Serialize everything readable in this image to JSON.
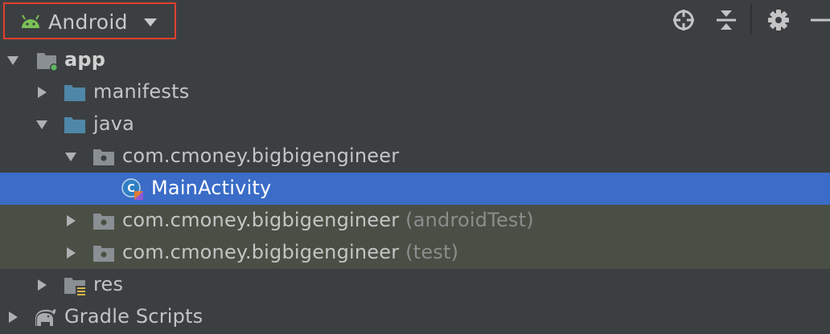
{
  "toolbar": {
    "view_label": "Android",
    "icons": [
      "android-icon",
      "dropdown-arrow-icon",
      "locate-icon",
      "collapse-all-icon",
      "gear-icon",
      "minimize-icon"
    ]
  },
  "tree": {
    "app": "app",
    "manifests": "manifests",
    "java": "java",
    "package_main": "com.cmoney.bigbigengineer",
    "main_activity": "MainActivity",
    "package_android_test": "com.cmoney.bigbigengineer",
    "android_test_suffix": "(androidTest)",
    "package_test": "com.cmoney.bigbigengineer",
    "test_suffix": "(test)",
    "res": "res",
    "gradle_scripts": "Gradle Scripts"
  },
  "colors": {
    "background": "#3c3f41",
    "selection": "#3a6cc8",
    "test_highlight": "#4a4f45",
    "annotation_box": "#e0412f",
    "android_green": "#78c257",
    "folder_blue": "#4f87a8"
  }
}
